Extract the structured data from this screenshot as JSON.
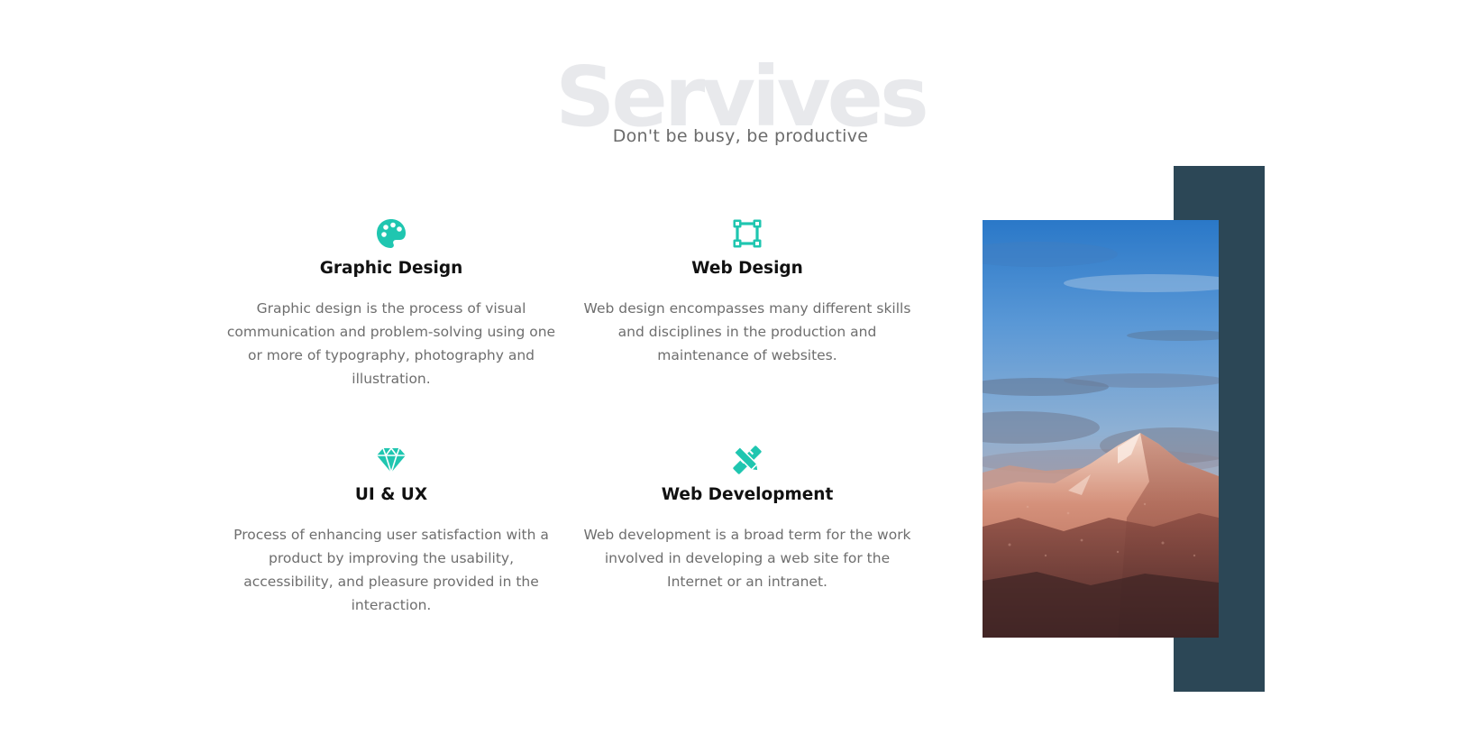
{
  "section": {
    "background_title": "Servives",
    "subtitle": "Don't be busy, be productive"
  },
  "services": [
    {
      "icon": "palette-icon",
      "title": "Graphic Design",
      "description": "Graphic design is the process of visual communication and problem-solving using one or more of typography, photography and illustration."
    },
    {
      "icon": "vector-square-icon",
      "title": "Web Design",
      "description": "Web design encompasses many different skills and disciplines in the production and maintenance of websites."
    },
    {
      "icon": "gem-icon",
      "title": "UI & UX",
      "description": "Process of enhancing user satisfaction with a product by improving the usability, accessibility, and pleasure provided in the interaction."
    },
    {
      "icon": "pencil-ruler-icon",
      "title": "Web Development",
      "description": "Web development is a broad term for the work involved in developing a web site for the Internet or an intranet."
    }
  ],
  "colors": {
    "accent": "#1fc6b0",
    "panel": "#2c4756",
    "title_text": "#111111",
    "body_text": "#6e6e6e",
    "background_title": "#e8e9ec"
  },
  "image": {
    "subject": "mountain-landscape"
  }
}
